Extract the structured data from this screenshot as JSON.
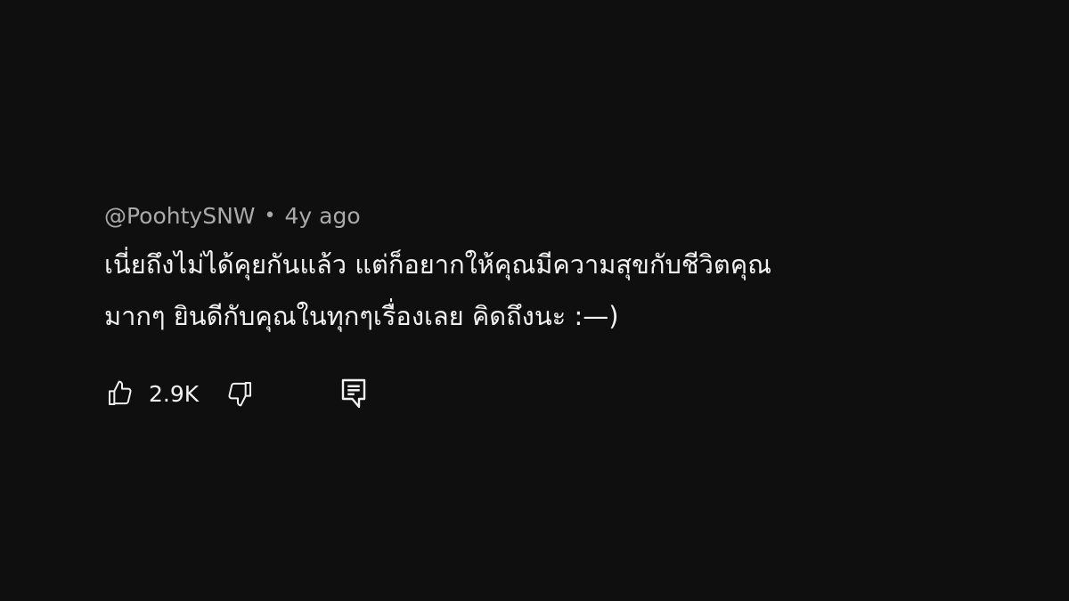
{
  "comment": {
    "author": "@PoohtySNW",
    "separator": "•",
    "time": "4y ago",
    "text_line1": "เนี่ยถึงไม่ได้คุยกันแล้ว แต่ก็อยากให้คุณมีความสุขกับชีวิตคุณ",
    "text_line2": "มากๆ ยินดีกับคุณในทุกๆเรื่องเลย คิดถึงนะ :—)"
  },
  "actions": {
    "like_count": "2.9K",
    "like_icon": "thumbs-up-icon",
    "dislike_icon": "thumbs-down-icon",
    "reply_icon": "reply-comment-icon"
  },
  "colors": {
    "background": "#0f0f0f",
    "text": "#f1f1f1",
    "meta": "#aaaaaa"
  }
}
